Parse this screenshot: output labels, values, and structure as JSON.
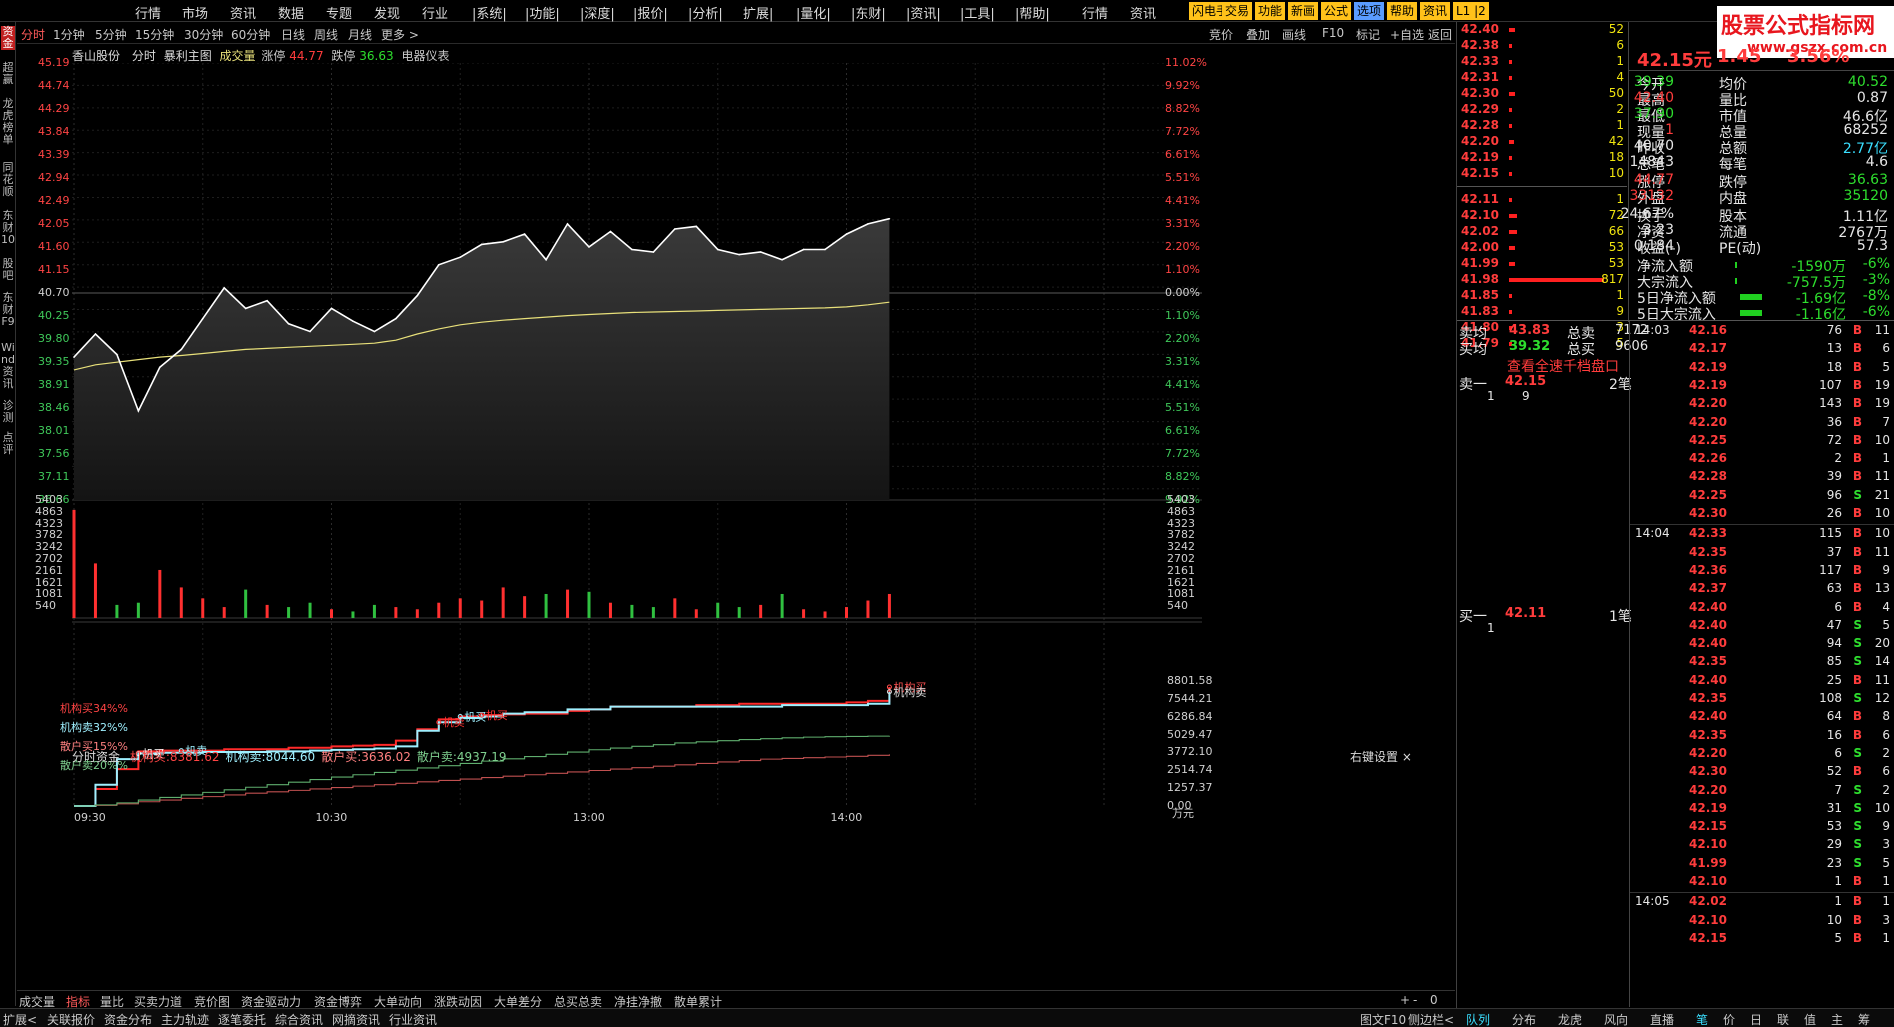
{
  "menu": {
    "items": [
      "行情",
      "市场",
      "资讯",
      "数据",
      "专题",
      "发现",
      "行业",
      "|系统|",
      "|功能|",
      "|深度|",
      "|报价|",
      "|分析|",
      "扩展|",
      "|量化|",
      "|东财|",
      "|资讯|",
      "|工具|",
      "|帮助|",
      "行情",
      "资讯"
    ],
    "quick": [
      {
        "label": "闪电手",
        "bg": "#ffc21a"
      },
      {
        "label": "交易",
        "bg": "#ffc21a"
      },
      {
        "label": "功能",
        "bg": "#ffc21a"
      },
      {
        "label": "新画",
        "bg": "#ffc21a"
      },
      {
        "label": "公式",
        "bg": "#ffc21a"
      },
      {
        "label": "选项",
        "bg": "#5a9cff"
      },
      {
        "label": "帮助",
        "bg": "#ffc21a"
      },
      {
        "label": "资讯",
        "bg": "#ffc21a"
      },
      {
        "label": "L1 |2",
        "bg": "#ffc21a"
      }
    ]
  },
  "leftbar": [
    "资金",
    "超赢",
    "龙虎榜单",
    "同花顺",
    "东财10",
    "股吧",
    "东财F9",
    "Wind资讯",
    "诊测",
    "点评"
  ],
  "periods": [
    "分时",
    "1分钟",
    "5分钟",
    "15分钟",
    "30分钟",
    "60分钟",
    "日线",
    "周线",
    "月线",
    "更多 >"
  ],
  "tools": [
    "竞价",
    "叠加",
    "画线",
    "F10",
    "标记",
    "+自选",
    "返回"
  ],
  "info": {
    "stock": "香山股份",
    "mode": "分时",
    "indicator": "暴利主图",
    "vol": "成交量",
    "zt_label": "涨停",
    "zt": "44.77",
    "dt_label": "跌停",
    "dt": "36.63",
    "sector": "电器仪表"
  },
  "price_axis": {
    "left": [
      "45.19",
      "44.74",
      "44.29",
      "43.84",
      "43.39",
      "42.94",
      "42.49",
      "42.05",
      "41.60",
      "41.15",
      "40.70",
      "40.25",
      "39.80",
      "39.35",
      "38.91",
      "38.46",
      "38.01",
      "37.56",
      "37.11",
      "36.66"
    ],
    "right": [
      "11.02%",
      "9.92%",
      "8.82%",
      "7.72%",
      "6.61%",
      "5.51%",
      "4.41%",
      "3.31%",
      "2.20%",
      "1.10%",
      "0.00%",
      "1.10%",
      "2.20%",
      "3.31%",
      "4.41%",
      "5.51%",
      "6.61%",
      "7.72%",
      "8.82%",
      "9.92%"
    ]
  },
  "vol_axis": [
    "5403",
    "4863",
    "4323",
    "3782",
    "3242",
    "2702",
    "2161",
    "1621",
    "1081",
    "540"
  ],
  "flow": {
    "title": "分时资金",
    "items": [
      {
        "k": "机构买:",
        "v": "8381.62"
      },
      {
        "k": "机构卖:",
        "v": "8044.60"
      },
      {
        "k": "散户买:",
        "v": "3636.02"
      },
      {
        "k": "散户卖:",
        "v": "4937.19"
      }
    ],
    "setting": "右键设置",
    "pct": [
      "机构买34%%",
      "机构卖32%%",
      "散户买15%%",
      "散户卖20%%"
    ],
    "axis": [
      "8801.58",
      "7544.21",
      "6286.84",
      "5029.47",
      "3772.10",
      "2514.74",
      "1257.37",
      "0.00"
    ],
    "unit": "万元",
    "tags": [
      "机买",
      "机卖",
      "机卖",
      "机买",
      "机构买",
      "机构卖",
      "机买"
    ]
  },
  "time_axis": [
    "09:30",
    "10:30",
    "13:00",
    "14:00"
  ],
  "chart_data": {
    "type": "line",
    "title": "香山股份 分时",
    "xlabel": "",
    "ylabel": "",
    "ylim": [
      36.66,
      45.19
    ],
    "prev_close": 40.7,
    "x": [
      "09:30",
      "09:35",
      "09:40",
      "09:45",
      "09:50",
      "09:55",
      "10:00",
      "10:05",
      "10:10",
      "10:15",
      "10:20",
      "10:25",
      "10:30",
      "10:35",
      "10:40",
      "10:45",
      "10:50",
      "10:55",
      "11:00",
      "11:05",
      "11:10",
      "11:15",
      "11:20",
      "11:25",
      "11:30",
      "13:00",
      "13:05",
      "13:10",
      "13:15",
      "13:20",
      "13:25",
      "13:30",
      "13:35",
      "13:40",
      "13:45",
      "13:50",
      "13:55",
      "14:00",
      "14:05"
    ],
    "series": [
      {
        "name": "price",
        "values": [
          39.45,
          39.9,
          39.5,
          38.4,
          39.25,
          39.6,
          40.2,
          40.8,
          40.4,
          40.55,
          40.1,
          39.95,
          40.4,
          40.15,
          39.95,
          40.2,
          40.65,
          41.25,
          41.4,
          41.65,
          41.7,
          41.85,
          41.35,
          42.05,
          41.6,
          41.9,
          41.55,
          41.5,
          41.95,
          42.0,
          41.55,
          41.45,
          41.5,
          41.35,
          41.55,
          41.55,
          41.85,
          42.05,
          42.15
        ]
      },
      {
        "name": "avg",
        "values": [
          39.2,
          39.3,
          39.35,
          39.4,
          39.45,
          39.48,
          39.52,
          39.56,
          39.6,
          39.62,
          39.64,
          39.66,
          39.68,
          39.7,
          39.72,
          39.78,
          39.9,
          40.0,
          40.08,
          40.13,
          40.17,
          40.2,
          40.23,
          40.26,
          40.28,
          40.3,
          40.32,
          40.33,
          40.34,
          40.35,
          40.36,
          40.37,
          40.38,
          40.39,
          40.4,
          40.41,
          40.43,
          40.47,
          40.52
        ]
      }
    ],
    "volume": [
      4950,
      2500,
      600,
      700,
      2200,
      1400,
      900,
      500,
      1300,
      600,
      500,
      700,
      400,
      300,
      600,
      500,
      400,
      700,
      900,
      800,
      1400,
      1000,
      1100,
      1300,
      1200,
      700,
      600,
      500,
      900,
      400,
      700,
      500,
      600,
      1100,
      400,
      300,
      500,
      800,
      1100
    ],
    "flow_series": [
      {
        "name": "机构买",
        "values": [
          0,
          1200,
          2600,
          3850,
          3900,
          3900,
          3900,
          4000,
          4000,
          4000,
          4100,
          4100,
          4200,
          4250,
          4300,
          4600,
          5400,
          6100,
          6300,
          6400,
          6450,
          6500,
          6500,
          6700,
          6800,
          7000,
          7000,
          7000,
          7000,
          7100,
          7100,
          7200,
          7200,
          7200,
          7200,
          7200,
          7300,
          7400,
          8381.62
        ]
      },
      {
        "name": "机构卖",
        "values": [
          0,
          1500,
          3300,
          3700,
          3750,
          3750,
          3800,
          3800,
          3800,
          3850,
          3850,
          3900,
          3950,
          4000,
          4050,
          4200,
          5300,
          5900,
          6200,
          6300,
          6500,
          6600,
          6600,
          6800,
          6800,
          7000,
          7000,
          7000,
          7000,
          7000,
          7000,
          7000,
          7000,
          7100,
          7100,
          7100,
          7100,
          7200,
          8044.6
        ]
      },
      {
        "name": "散户买",
        "values": [
          0,
          50,
          150,
          300,
          420,
          540,
          660,
          780,
          900,
          1000,
          1100,
          1200,
          1300,
          1400,
          1500,
          1600,
          1700,
          1800,
          1900,
          2000,
          2100,
          2200,
          2300,
          2400,
          2500,
          2600,
          2700,
          2800,
          2900,
          3000,
          3100,
          3200,
          3300,
          3350,
          3400,
          3450,
          3500,
          3570,
          3636.02
        ]
      },
      {
        "name": "散户卖",
        "values": [
          0,
          80,
          220,
          420,
          600,
          780,
          960,
          1140,
          1320,
          1500,
          1680,
          1860,
          2040,
          2200,
          2360,
          2520,
          2680,
          2840,
          3000,
          3160,
          3320,
          3480,
          3640,
          3800,
          3960,
          4080,
          4200,
          4320,
          4440,
          4520,
          4600,
          4680,
          4740,
          4800,
          4850,
          4880,
          4900,
          4920,
          4937.19
        ]
      }
    ]
  },
  "tabs": [
    "成交量",
    "指标",
    "量比",
    "买卖力道",
    "竞价图",
    "资金驱动力",
    "资金博弈",
    "大单动向",
    "涨跌动因",
    "大单差分",
    "总买总卖",
    "净挂净撤",
    "散单累计"
  ],
  "status": [
    "扩展<",
    "关联报价",
    "资金分布",
    "主力轨迹",
    "逐笔委托",
    "综合资讯",
    "网摘资讯",
    "行业资讯"
  ],
  "status_right": [
    "图文F10",
    "侧边栏<"
  ],
  "rtabs": [
    "队列",
    "分布",
    "龙虎",
    "风向",
    "直播",
    "笔",
    "价",
    "日",
    "联",
    "值",
    "主",
    "筹"
  ],
  "orderbook": {
    "asks": [
      [
        "42.40",
        52
      ],
      [
        "42.38",
        6
      ],
      [
        "42.33",
        1
      ],
      [
        "42.31",
        4
      ],
      [
        "42.30",
        50
      ],
      [
        "42.29",
        2
      ],
      [
        "42.28",
        1
      ],
      [
        "42.20",
        42
      ],
      [
        "42.19",
        18
      ],
      [
        "42.15",
        10
      ]
    ],
    "bids": [
      [
        "42.11",
        1
      ],
      [
        "42.10",
        72
      ],
      [
        "42.02",
        66
      ],
      [
        "42.00",
        53
      ],
      [
        "41.99",
        53
      ],
      [
        "41.98",
        817
      ],
      [
        "41.85",
        1
      ],
      [
        "41.83",
        9
      ],
      [
        "41.80",
        3
      ],
      [
        "41.79",
        5
      ]
    ],
    "avg_sell_label": "卖均",
    "avg_sell": "43.83",
    "tot_sell_label": "总卖",
    "tot_sell": "7172",
    "avg_buy_label": "买均",
    "avg_buy": "39.32",
    "tot_buy_label": "总买",
    "tot_buy": "9606",
    "link": "查看全速千档盘口",
    "sell1_label": "卖一",
    "sell1": "42.15",
    "sell1_cnt": "2笔",
    "sell1_q": [
      "1",
      "9"
    ],
    "buy1_label": "买一",
    "buy1": "42.11",
    "buy1_cnt": "1笔",
    "buy1_q": "1"
  },
  "quote": {
    "price": "42.15元",
    "chg": "1.45",
    "pct": "3.56%",
    "stats": [
      [
        "今开",
        "39.39",
        "均价",
        "40.52"
      ],
      [
        "最高",
        "42.40",
        "量比",
        "0.87"
      ],
      [
        "最低",
        "37.90",
        "市值",
        "46.6亿"
      ],
      [
        "现量",
        "1",
        "总量",
        "68252"
      ],
      [
        "昨收",
        "40.70",
        "总额",
        "2.77亿"
      ],
      [
        "总笔",
        "14843",
        "每笔",
        "4.6"
      ],
      [
        "涨停",
        "44.77",
        "跌停",
        "36.63"
      ],
      [
        "外盘",
        "33132",
        "内盘",
        "35120"
      ],
      [
        "换手",
        "24.67%",
        "股本",
        "1.11亿"
      ],
      [
        "净资",
        "3.23",
        "流通",
        "2767万"
      ],
      [
        "收益(-)",
        "0.184",
        "PE(动)",
        "57.3"
      ]
    ],
    "flows": [
      [
        "净流入额",
        "-1590万",
        "-6%"
      ],
      [
        "大宗流入",
        "-757.5万",
        "-3%"
      ],
      [
        "5日净流入额",
        "-1.69亿",
        "-8%"
      ],
      [
        "5日大宗流入",
        "-1.16亿",
        "-6%"
      ]
    ]
  },
  "ticks": [
    [
      "14:03",
      "42.16",
      "76",
      "B",
      "11"
    ],
    [
      "",
      "42.17",
      "13",
      "B",
      "6"
    ],
    [
      "",
      "42.19",
      "18",
      "B",
      "5"
    ],
    [
      "",
      "42.19",
      "107",
      "B",
      "19"
    ],
    [
      "",
      "42.20",
      "143",
      "B",
      "19"
    ],
    [
      "",
      "42.20",
      "36",
      "B",
      "7"
    ],
    [
      "",
      "42.25",
      "72",
      "B",
      "10"
    ],
    [
      "",
      "42.26",
      "2",
      "B",
      "1"
    ],
    [
      "",
      "42.28",
      "39",
      "B",
      "11"
    ],
    [
      "",
      "42.25",
      "96",
      "S",
      "21"
    ],
    [
      "",
      "42.30",
      "26",
      "B",
      "10"
    ],
    [
      "14:04",
      "42.33",
      "115",
      "B",
      "10"
    ],
    [
      "",
      "42.35",
      "37",
      "B",
      "11"
    ],
    [
      "",
      "42.36",
      "117",
      "B",
      "9"
    ],
    [
      "",
      "42.37",
      "63",
      "B",
      "13"
    ],
    [
      "",
      "42.40",
      "6",
      "B",
      "4"
    ],
    [
      "",
      "42.40",
      "47",
      "S",
      "5"
    ],
    [
      "",
      "42.40",
      "94",
      "S",
      "20"
    ],
    [
      "",
      "42.35",
      "85",
      "S",
      "14"
    ],
    [
      "",
      "42.40",
      "25",
      "B",
      "11"
    ],
    [
      "",
      "42.35",
      "108",
      "S",
      "12"
    ],
    [
      "",
      "42.40",
      "64",
      "B",
      "8"
    ],
    [
      "",
      "42.35",
      "16",
      "B",
      "6"
    ],
    [
      "",
      "42.20",
      "6",
      "S",
      "2"
    ],
    [
      "",
      "42.30",
      "52",
      "B",
      "6"
    ],
    [
      "",
      "42.20",
      "7",
      "S",
      "2"
    ],
    [
      "",
      "42.19",
      "31",
      "S",
      "10"
    ],
    [
      "",
      "42.15",
      "53",
      "S",
      "9"
    ],
    [
      "",
      "42.10",
      "29",
      "S",
      "3"
    ],
    [
      "",
      "41.99",
      "23",
      "S",
      "5"
    ],
    [
      "",
      "42.10",
      "1",
      "B",
      "1"
    ],
    [
      "14:05",
      "42.02",
      "1",
      "B",
      "1"
    ],
    [
      "",
      "42.10",
      "10",
      "B",
      "3"
    ],
    [
      "",
      "42.15",
      "5",
      "B",
      "1"
    ]
  ],
  "logo": {
    "line1": "股票公式指标网",
    "line2": "www.gszx.com.cn"
  },
  "colors": {
    "up": "#ff3c3c",
    "down": "#2ede2e",
    "price": "#ffffff",
    "avg": "#e8e07a",
    "inst_buy": "#ff2a2a",
    "inst_sell": "#9ff0ff",
    "retail_buy": "#c05050",
    "retail_sell": "#5fae6e"
  }
}
